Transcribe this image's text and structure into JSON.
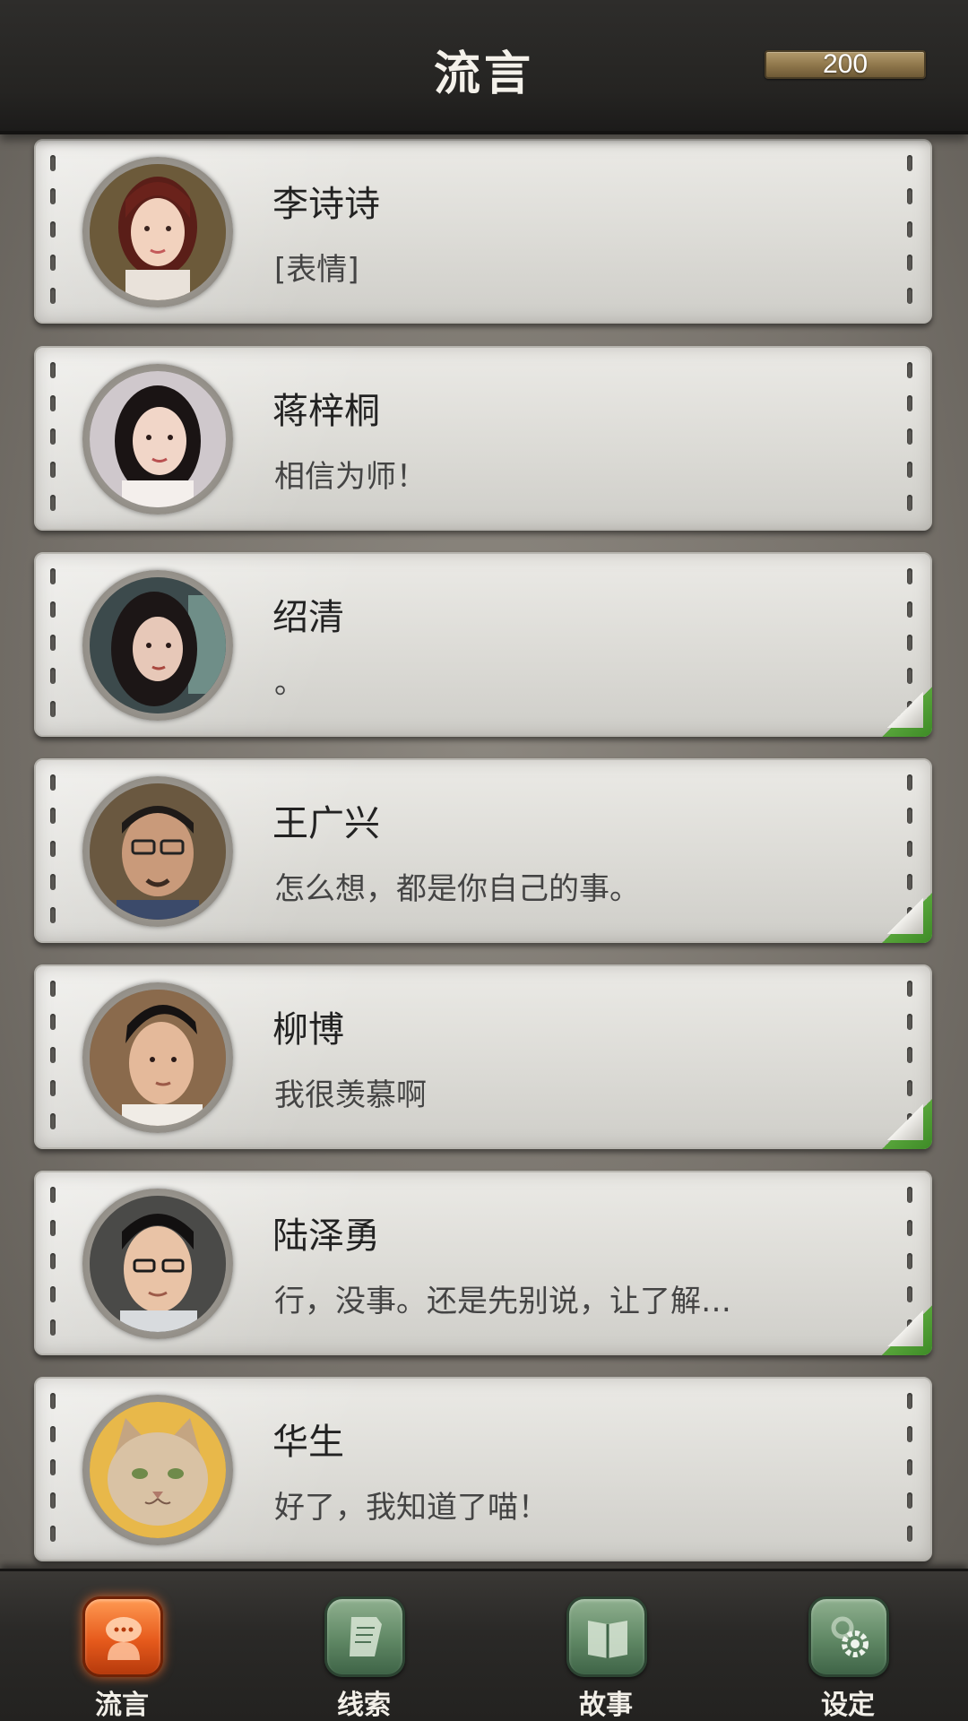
{
  "header": {
    "title": "流言",
    "coins": "200"
  },
  "conversations": [
    {
      "name": "李诗诗",
      "message": "[表情]",
      "avatar_icon": "woman-avatar-icon",
      "read_flag": false
    },
    {
      "name": "蒋梓桐",
      "message": "相信为师！",
      "avatar_icon": "woman-avatar-icon",
      "read_flag": false
    },
    {
      "name": "绍清",
      "message": "。",
      "avatar_icon": "woman-avatar-icon",
      "read_flag": true
    },
    {
      "name": "王广兴",
      "message": "怎么想，都是你自己的事。",
      "avatar_icon": "man-avatar-icon",
      "read_flag": true
    },
    {
      "name": "柳博",
      "message": "我很羡慕啊",
      "avatar_icon": "man-avatar-icon",
      "read_flag": true
    },
    {
      "name": "陆泽勇",
      "message": "行，没事。还是先别说，让了解…",
      "avatar_icon": "man-avatar-icon",
      "read_flag": true
    },
    {
      "name": "华生",
      "message": "好了，我知道了喵！",
      "avatar_icon": "cat-avatar-icon",
      "read_flag": false
    }
  ],
  "tabs": [
    {
      "label": "流言",
      "icon": "chat-bubble-icon",
      "active": true
    },
    {
      "label": "线索",
      "icon": "document-icon",
      "active": false
    },
    {
      "label": "故事",
      "icon": "book-icon",
      "active": false
    },
    {
      "label": "设定",
      "icon": "gear-icon",
      "active": false
    }
  ],
  "colors": {
    "active_tab": "#e65a1c",
    "inactive_tab": "#5f8764",
    "unread_flag": "#4a9a30"
  }
}
